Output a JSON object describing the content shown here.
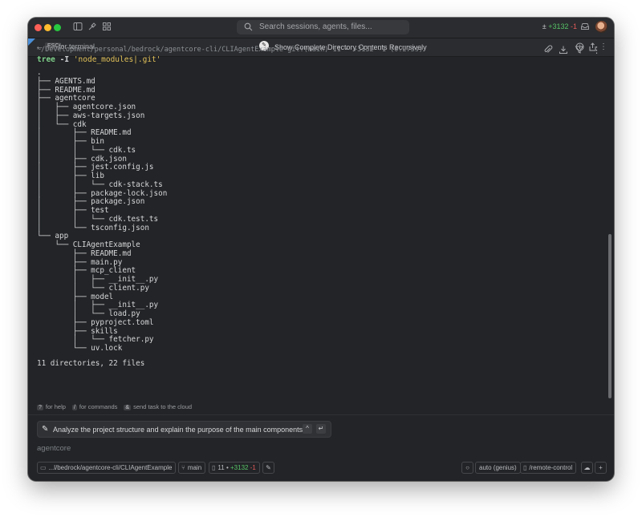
{
  "titlebar": {
    "search_placeholder": "Search sessions, agents, files...",
    "diff": {
      "plus": "+3132",
      "minus": "-1"
    }
  },
  "subbar": {
    "esc_key": "ESC",
    "esc_label": "for terminal",
    "title": "Show Complete Directory Contents Recursively"
  },
  "terminal": {
    "prompt": "~/Development/personal/bedrock/agentcore-cli/CLIAgentExample git:(main) 11 • +3132 -1 (0.273s)",
    "command_name": "tree",
    "command_flag": "-I",
    "command_arg": "'node_modules|.git'",
    "output": ".\n├── AGENTS.md\n├── README.md\n├── agentcore\n│   ├── agentcore.json\n│   ├── aws-targets.json\n│   └── cdk\n│       ├── README.md\n│       ├── bin\n│       │   └── cdk.ts\n│       ├── cdk.json\n│       ├── jest.config.js\n│       ├── lib\n│       │   └── cdk-stack.ts\n│       ├── package-lock.json\n│       ├── package.json\n│       ├── test\n│       │   └── cdk.test.ts\n│       └── tsconfig.json\n└── app\n    └── CLIAgentExample\n        ├── README.md\n        ├── main.py\n        ├── mcp_client\n        │   ├── __init__.py\n        │   └── client.py\n        ├── model\n        │   ├── __init__.py\n        │   └── load.py\n        ├── pyproject.toml\n        ├── skills\n        │   └── fetcher.py\n        └── uv.lock",
    "summary": "11 directories, 22 files"
  },
  "hints": [
    {
      "key": "?",
      "label": "for help"
    },
    {
      "key": "/",
      "label": "for commands"
    },
    {
      "key": "&",
      "label": "send task to the cloud"
    }
  ],
  "suggestion": {
    "text": "Analyze the project structure and explain the purpose of the main components."
  },
  "input": {
    "placeholder": "agentcore"
  },
  "statusbar": {
    "path": "...l/bedrock/agentcore-cli/CLIAgentExample",
    "branch": "main",
    "changes": "11",
    "plus": "+3132",
    "minus": "-1",
    "model": "auto (genius)",
    "remote": "/remote-control"
  }
}
